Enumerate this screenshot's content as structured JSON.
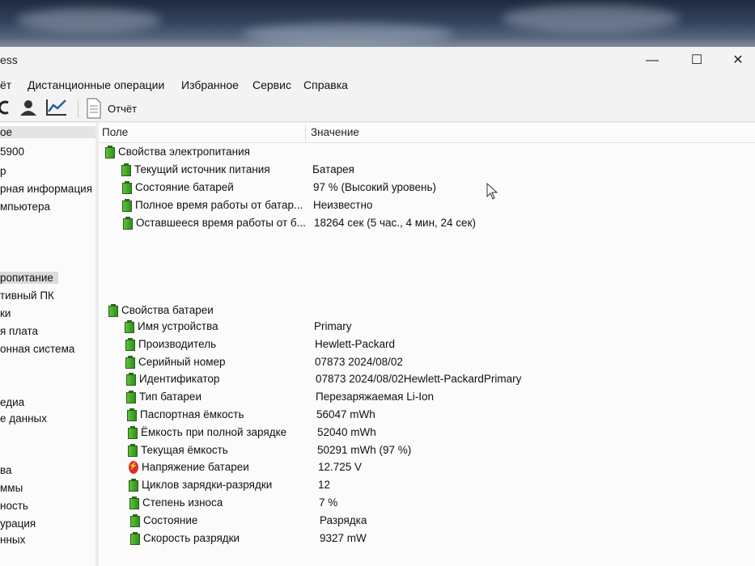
{
  "window": {
    "title": "ess",
    "controls": {
      "minimize": "—",
      "maximize": "☐",
      "close": "✕"
    }
  },
  "menu": [
    "ёт",
    "Дистанционные операции",
    "Избранное",
    "Сервис",
    "Справка"
  ],
  "toolbar": {
    "report_label": "Отчёт"
  },
  "left_tree": [
    {
      "label": "ое",
      "selected": false
    },
    {
      "label": "5900",
      "selected": false
    },
    {
      "label": "р",
      "selected": false
    },
    {
      "label": "рная информация",
      "selected": false
    },
    {
      "label": "мпьютера",
      "selected": false
    },
    {
      "label": "ропитание",
      "selected": true
    },
    {
      "label": "тивный ПК",
      "selected": false
    },
    {
      "label": "ки",
      "selected": false
    },
    {
      "label": "я плата",
      "selected": false
    },
    {
      "label": "онная система",
      "selected": false
    },
    {
      "label": "едиа",
      "selected": false
    },
    {
      "label": "е данных",
      "selected": false
    },
    {
      "label": "ва",
      "selected": false
    },
    {
      "label": "ммы",
      "selected": false
    },
    {
      "label": "ность",
      "selected": false
    },
    {
      "label": "урация",
      "selected": false
    },
    {
      "label": "нных",
      "selected": false
    }
  ],
  "columns": {
    "field": "Поле",
    "value": "Значение"
  },
  "power_group": {
    "title": "Свойства электропитания",
    "rows": [
      {
        "field": "Текущий источник питания",
        "value": "Батарея",
        "icon": "battery-icon"
      },
      {
        "field": "Состояние батарей",
        "value": "97 % (Высокий уровень)",
        "icon": "battery-icon"
      },
      {
        "field": "Полное время работы от батар...",
        "value": "Неизвестно",
        "icon": "battery-icon"
      },
      {
        "field": "Оставшееся время работы от б...",
        "value": "18264 сек (5 час., 4 мин, 24 сек)",
        "icon": "battery-icon"
      }
    ]
  },
  "battery_group": {
    "title": "Свойства батареи",
    "rows": [
      {
        "field": "Имя устройства",
        "value": "Primary",
        "icon": "battery-icon"
      },
      {
        "field": "Производитель",
        "value": "Hewlett-Packard",
        "icon": "battery-icon"
      },
      {
        "field": "Серийный номер",
        "value": "07873 2024/08/02",
        "icon": "battery-icon"
      },
      {
        "field": "Идентификатор",
        "value": "07873 2024/08/02Hewlett-PackardPrimary",
        "icon": "battery-icon"
      },
      {
        "field": "Тип батареи",
        "value": "Перезаряжаемая Li-Ion",
        "icon": "battery-icon"
      },
      {
        "field": "Паспортная ёмкость",
        "value": "56047 mWh",
        "icon": "battery-icon"
      },
      {
        "field": "Ёмкость при полной зарядке",
        "value": "52040 mWh",
        "icon": "battery-icon"
      },
      {
        "field": "Текущая ёмкость",
        "value": "50291 mWh  (97 %)",
        "icon": "battery-icon"
      },
      {
        "field": "Напряжение батареи",
        "value": "12.725 V",
        "icon": "voltage-icon"
      },
      {
        "field": "Циклов зарядки-разрядки",
        "value": "12",
        "icon": "battery-icon"
      },
      {
        "field": "Степень износа",
        "value": "7 %",
        "icon": "battery-icon"
      },
      {
        "field": "Состояние",
        "value": "Разрядка",
        "icon": "battery-icon"
      },
      {
        "field": "Скорость разрядки",
        "value": "9327 mW",
        "icon": "battery-icon"
      }
    ]
  }
}
